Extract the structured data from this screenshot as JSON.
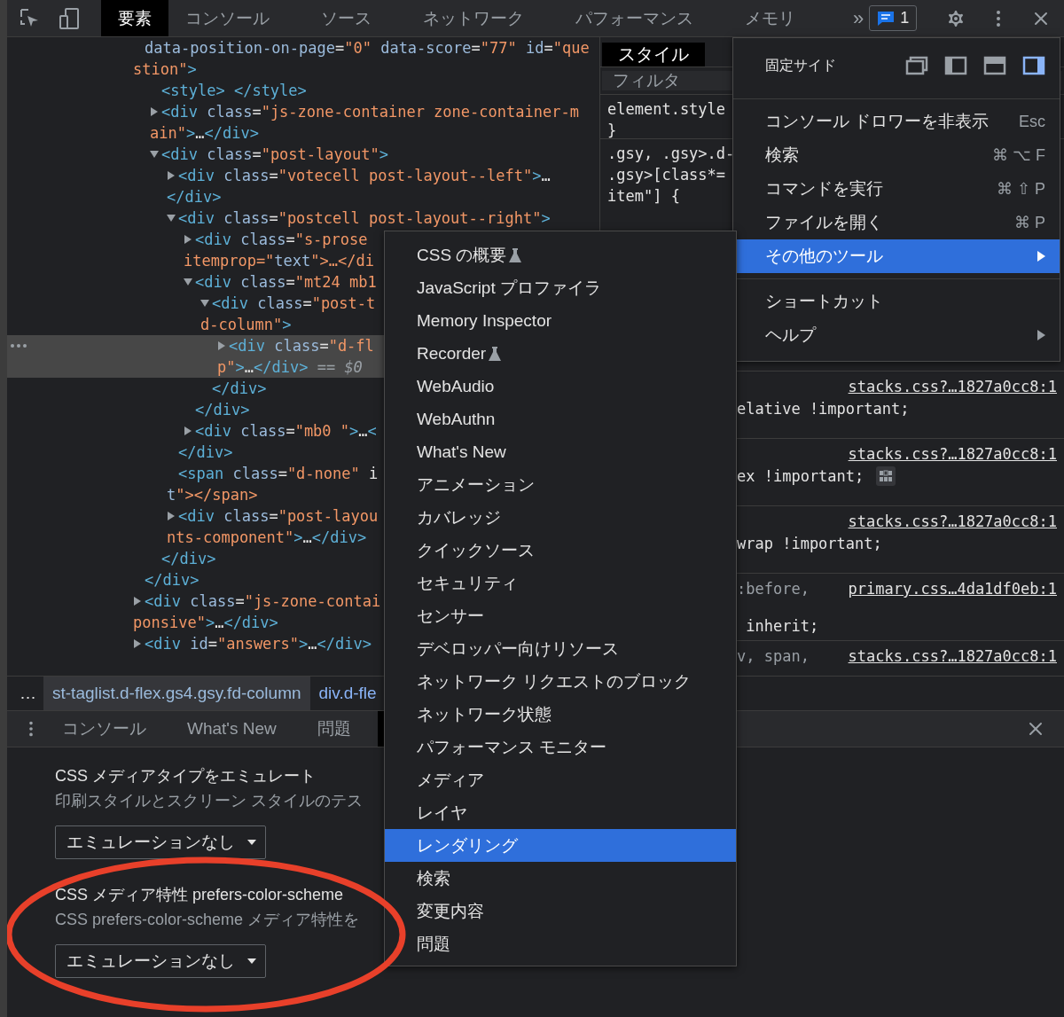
{
  "toolbar": {
    "tabs": [
      {
        "label": "要素",
        "selected": true
      },
      {
        "label": "コンソール",
        "selected": false
      },
      {
        "label": "ソース",
        "selected": false
      },
      {
        "label": "ネットワーク",
        "selected": false
      },
      {
        "label": "パフォーマンス",
        "selected": false
      },
      {
        "label": "メモリ",
        "selected": false
      }
    ],
    "more": "»",
    "issues": "1"
  },
  "elements": {
    "nodes": [
      {
        "lines": [
          "data-position-on-page=\"0\" data-score=\"77\" id=\"que",
          "stion\">"
        ],
        "selected": false,
        "children": [
          {
            "lines": [
              "<style> </style>"
            ],
            "selected": false
          },
          {
            "lines": [
              "<div class=\"js-zone-container zone-container-m",
              "ain\">…</div>"
            ],
            "expanded": false,
            "selected": false
          },
          {
            "lines": [
              "<div class=\"post-layout\">"
            ],
            "expanded": true,
            "selected": false,
            "children": [
              {
                "lines": [
                  "<div class=\"votecell post-layout--left\">…",
                  "</div>"
                ],
                "expanded": false,
                "selected": false
              },
              {
                "lines": [
                  "<div class=\"postcell post-layout--right\">"
                ],
                "expanded": true,
                "selected": false,
                "children": [
                  {
                    "lines": [
                      "<div class=\"s-prose",
                      "itemprop=\"text\">…</di"
                    ],
                    "expanded": false,
                    "selected": false
                  },
                  {
                    "lines": [
                      "<div class=\"mt24 mb1"
                    ],
                    "expanded": true,
                    "selected": false,
                    "children": [
                      {
                        "lines": [
                          "<div class=\"post-t",
                          "d-column\">"
                        ],
                        "expanded": true,
                        "selected": false,
                        "children": [
                          {
                            "lines": [
                              "<div class=\"d-fl",
                              "p\">…</div> == $0"
                            ],
                            "expanded": false,
                            "selected": true
                          }
                        ]
                      },
                      {
                        "lines": [
                          "</div>"
                        ],
                        "selected": false
                      }
                    ]
                  },
                  {
                    "lines": [
                      "</div>"
                    ],
                    "selected": false
                  },
                  {
                    "lines": [
                      "<div class=\"mb0 \">…<"
                    ],
                    "expanded": false,
                    "selected": false
                  }
                ]
              },
              {
                "lines": [
                  "</div>"
                ],
                "selected": false
              },
              {
                "lines": [
                  "<span class=\"d-none\" i",
                  "t\"></span>"
                ],
                "selected": false
              },
              {
                "lines": [
                  "<div class=\"post-layou",
                  "nts-component\">…</div>"
                ],
                "expanded": false,
                "selected": false
              }
            ]
          },
          {
            "lines": [
              "</div>"
            ],
            "selected": false
          }
        ]
      },
      {
        "lines": [
          "</div>"
        ],
        "selected": false
      },
      {
        "lines": [
          "<div class=\"js-zone-contai",
          "ponsive\">…</div>"
        ],
        "expanded": false,
        "selected": false
      },
      {
        "lines": [
          "<div id=\"answers\">…</div>"
        ],
        "expanded": false,
        "selected": false
      }
    ]
  },
  "breadcrumbs": {
    "more": "…",
    "items": [
      {
        "label": "st-taglist.d-flex.gs4.gsy.fd-column",
        "selected": true
      },
      {
        "label": "div.d-fle",
        "selected": false
      }
    ]
  },
  "styles": {
    "tabs": [
      {
        "label": "スタイル",
        "selected": true
      }
    ],
    "filter": {
      "placeholder": "フィルタ"
    },
    "rules": [
      {
        "kind": "head",
        "lines": [
          "element.style",
          "}"
        ]
      },
      {
        "kind": "head",
        "lines": [
          ".gsy, .gsy>.d-",
          ".gsy>[class*=",
          "item\"] {"
        ]
      },
      {
        "kind": "tail",
        "link": "stacks.css?…1827a0cc8:1",
        "declarations": [
          "elative !important;"
        ]
      },
      {
        "kind": "tail",
        "link": "stacks.css?…1827a0cc8:1",
        "declarations": [
          "ex !important;"
        ],
        "flex_icon": true
      },
      {
        "kind": "tail",
        "link": "stacks.css?…1827a0cc8:1",
        "declarations": [
          "wrap !important;"
        ]
      },
      {
        "kind": "tail",
        "selector": ":before,",
        "link": "primary.css…4da1df0eb:1",
        "declarations": [
          " inherit;"
        ]
      },
      {
        "kind": "tail",
        "selector": "v, span,",
        "link": "stacks.css?…1827a0cc8:1"
      }
    ]
  },
  "drawer": {
    "tabs": [
      {
        "label": "コンソール",
        "selected": false
      },
      {
        "label": "What's New",
        "selected": false
      },
      {
        "label": "問題",
        "selected": false
      },
      {
        "selected": true
      }
    ],
    "sections": [
      {
        "title": "CSS メディアタイプをエミュレート",
        "description": "印刷スタイルとスクリーン スタイルのテス",
        "value": "エミュレーションなし"
      },
      {
        "title": "CSS メディア特性 prefers-color-scheme",
        "description": "CSS prefers-color-scheme メディア特性を",
        "value": "エミュレーションなし"
      }
    ]
  },
  "menu": {
    "dock": {
      "label": "固定サイド",
      "options": [
        {
          "kind": "undock",
          "selected": false
        },
        {
          "kind": "left",
          "selected": false
        },
        {
          "kind": "bottom",
          "selected": false
        },
        {
          "kind": "right",
          "selected": true
        }
      ]
    },
    "groups": [
      [
        {
          "label": "コンソール ドロワーを非表示",
          "shortcut": "Esc",
          "selected": false
        },
        {
          "label": "検索",
          "shortcut": "⌘ ⌥ F",
          "selected": false
        },
        {
          "label": "コマンドを実行",
          "shortcut": "⌘ ⇧ P",
          "selected": false
        },
        {
          "label": "ファイルを開く",
          "shortcut": "⌘ P",
          "selected": false
        },
        {
          "label": "その他のツール",
          "submenu": true,
          "selected": true
        }
      ],
      [
        {
          "label": "ショートカット",
          "selected": false
        },
        {
          "label": "ヘルプ",
          "submenu": true,
          "selected": false
        }
      ]
    ]
  },
  "submenu": {
    "items": [
      {
        "label": "CSS の概要",
        "experimental": true,
        "selected": false
      },
      {
        "label": "JavaScript プロファイラ",
        "selected": false
      },
      {
        "label": "Memory Inspector",
        "selected": false
      },
      {
        "label": "Recorder",
        "experimental": true,
        "selected": false
      },
      {
        "label": "WebAudio",
        "selected": false
      },
      {
        "label": "WebAuthn",
        "selected": false
      },
      {
        "label": "What's New",
        "selected": false
      },
      {
        "label": "アニメーション",
        "selected": false
      },
      {
        "label": "カバレッジ",
        "selected": false
      },
      {
        "label": "クイックソース",
        "selected": false
      },
      {
        "label": "セキュリティ",
        "selected": false
      },
      {
        "label": "センサー",
        "selected": false
      },
      {
        "label": "デベロッパー向けリソース",
        "selected": false
      },
      {
        "label": "ネットワーク リクエストのブロック",
        "selected": false
      },
      {
        "label": "ネットワーク状態",
        "selected": false
      },
      {
        "label": "パフォーマンス モニター",
        "selected": false
      },
      {
        "label": "メディア",
        "selected": false
      },
      {
        "label": "レイヤ",
        "selected": false
      },
      {
        "label": "レンダリング",
        "selected": true
      },
      {
        "label": "検索",
        "selected": false
      },
      {
        "label": "変更内容",
        "selected": false
      },
      {
        "label": "問題",
        "selected": false
      }
    ]
  },
  "annotation": {
    "kind": "ellipse"
  }
}
